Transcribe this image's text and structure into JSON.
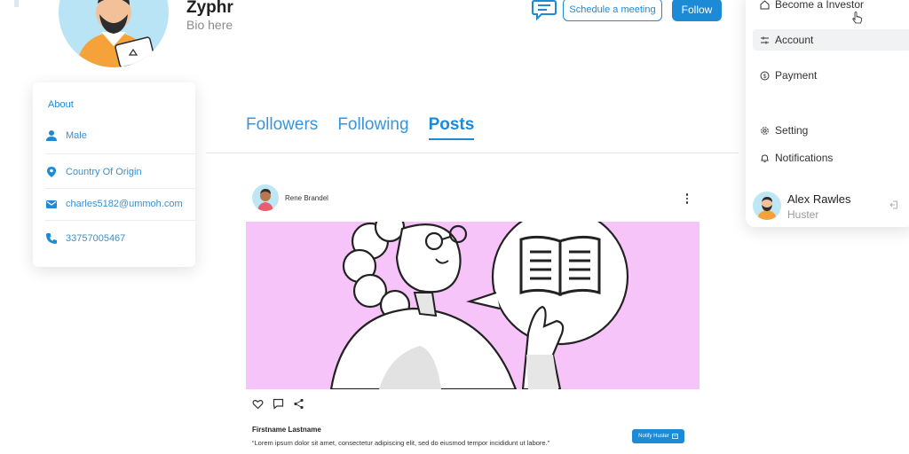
{
  "profile": {
    "name": "Zyphr",
    "bio": "Bio here"
  },
  "header": {
    "schedule_label": "Schedule a meeting",
    "follow_label": "Follow"
  },
  "about": {
    "title": "About",
    "gender": "Male",
    "country": "Country Of Origin",
    "email": "charles5182@ummoh.com",
    "phone": "33757005467"
  },
  "tabs": [
    {
      "label": "Followers"
    },
    {
      "label": "Following"
    },
    {
      "label": "Posts"
    }
  ],
  "post": {
    "author": "Rene Brandel",
    "title": "Firstname Lastname",
    "body": "“Lorem ipsum dolor sit amet, consectetur adipiscing elit, sed do eiusmod tempor incididunt ut labore.”",
    "notify_label": "Notify Huster"
  },
  "menu": {
    "items": [
      {
        "label": "Become a Investor",
        "icon": "home-icon"
      },
      {
        "label": "Account",
        "icon": "sliders-icon"
      },
      {
        "label": "Payment",
        "icon": "dollar-icon"
      },
      {
        "label": "Setting",
        "icon": "gear-icon"
      },
      {
        "label": "Notifications",
        "icon": "bell-icon"
      }
    ],
    "user": {
      "name": "Alex Rawles",
      "role": "Huster"
    }
  },
  "colors": {
    "accent": "#1d8ad6",
    "post_image_bg": "#f7c4f9",
    "avatar_bg": "#b9e4f6"
  }
}
